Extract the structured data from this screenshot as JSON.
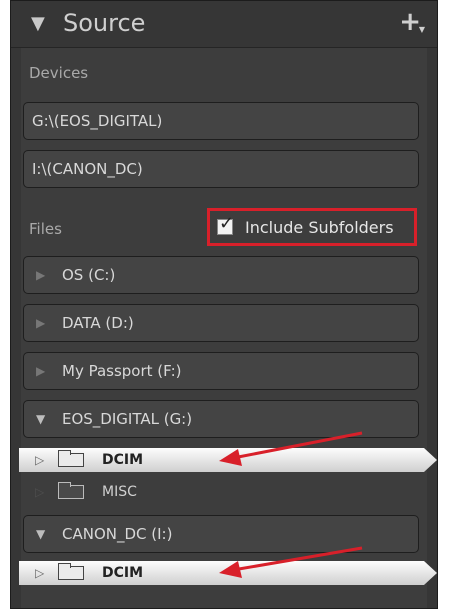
{
  "header": {
    "title": "Source",
    "collapse_glyph": "▼",
    "add_glyph": "+",
    "add_caret": "▼"
  },
  "devices": {
    "label": "Devices",
    "items": [
      {
        "label": "G:\\(EOS_DIGITAL)"
      },
      {
        "label": "I:\\(CANON_DC)"
      }
    ]
  },
  "files": {
    "label": "Files",
    "include_subfolders": {
      "label": "Include Subfolders",
      "checked": true,
      "checkmark": "✓"
    },
    "drives": [
      {
        "label": "OS (C:)",
        "expanded": false,
        "glyph": "▶"
      },
      {
        "label": "DATA (D:)",
        "expanded": false,
        "glyph": "▶"
      },
      {
        "label": "My Passport (F:)",
        "expanded": false,
        "glyph": "▶"
      },
      {
        "label": "EOS_DIGITAL (G:)",
        "expanded": true,
        "glyph": "▼"
      },
      {
        "label": "CANON_DC (I:)",
        "expanded": true,
        "glyph": "▼"
      }
    ],
    "folders_g": [
      {
        "name": "DCIM",
        "selected": true,
        "glyph": "▷"
      },
      {
        "name": "MISC",
        "selected": false,
        "glyph": "▷"
      }
    ],
    "folders_i": [
      {
        "name": "DCIM",
        "selected": true,
        "glyph": "▷"
      }
    ]
  },
  "annotation_color": "#d8202a"
}
